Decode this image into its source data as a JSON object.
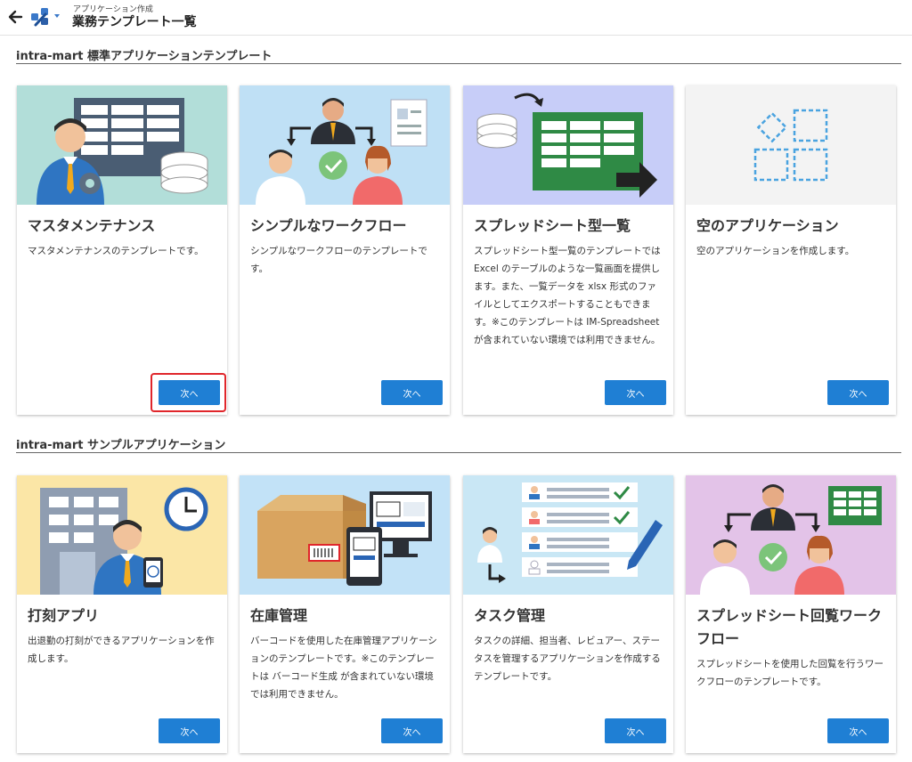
{
  "header": {
    "breadcrumb": "アプリケーション作成",
    "title": "業務テンプレート一覧"
  },
  "sections": [
    {
      "title": "intra-mart 標準アプリケーションテンプレート",
      "cards": [
        {
          "title": "マスタメンテナンス",
          "description": "マスタメンテナンスのテンプレートです。",
          "button": "次へ"
        },
        {
          "title": "シンプルなワークフロー",
          "description": "シンプルなワークフローのテンプレートです。",
          "button": "次へ"
        },
        {
          "title": "スプレッドシート型一覧",
          "description": "スプレッドシート型一覧のテンプレートではExcel のテーブルのような一覧画面を提供します。また、一覧データを xlsx 形式のファイルとしてエクスポートすることもできます。※このテンプレートは IM-Spreadsheet が含まれていない環境では利用できません。",
          "button": "次へ"
        },
        {
          "title": "空のアプリケーション",
          "description": "空のアプリケーションを作成します。",
          "button": "次へ"
        }
      ]
    },
    {
      "title": "intra-mart サンプルアプリケーション",
      "cards": [
        {
          "title": "打刻アプリ",
          "description": "出退勤の打刻ができるアプリケーションを作成します。",
          "button": "次へ"
        },
        {
          "title": "在庫管理",
          "description": "バーコードを使用した在庫管理アプリケーションのテンプレートです。※このテンプレートは バーコード生成 が含まれていない環境では利用できません。",
          "button": "次へ"
        },
        {
          "title": "タスク管理",
          "description": "タスクの詳細、担当者、レビュアー、ステータスを管理するアプリケーションを作成するテンプレートです。",
          "button": "次へ"
        },
        {
          "title": "スプレッドシート回覧ワークフロー",
          "description": "スプレッドシートを使用した回覧を行うワークフローのテンプレートです。",
          "button": "次へ"
        }
      ]
    }
  ],
  "colors": {
    "accent": "#1f7fd4",
    "highlight": "#e0262b",
    "img_master": "#b2ded9",
    "img_workflow": "#bfe0f5",
    "img_spreadsheet": "#c7cdf8",
    "img_empty": "#f3f3f3",
    "img_clock": "#fbe6a6",
    "img_inventory": "#c2e2f7",
    "img_task": "#c9e7f5",
    "img_circulation": "#e3c3e8"
  },
  "icons": {
    "back": "arrow-left-icon",
    "app": "wrench-app-icon",
    "dropdown": "caret-down-icon"
  }
}
